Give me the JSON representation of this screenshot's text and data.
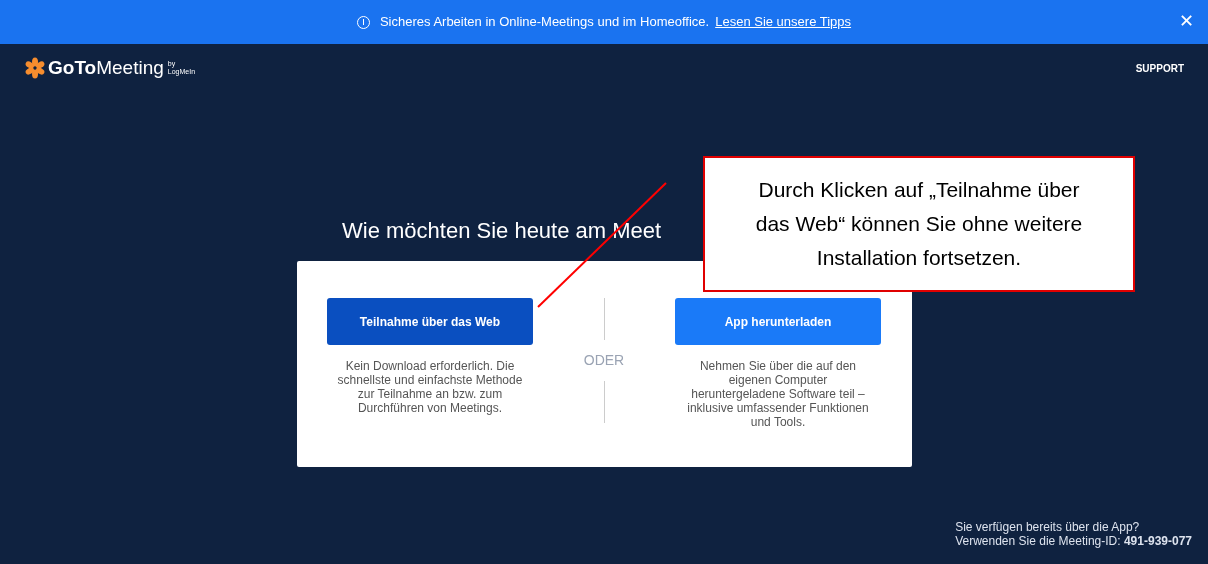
{
  "banner": {
    "message": "Sicheres Arbeiten in Online-Meetings und im Homeoffice.",
    "link": "Lesen Sie unsere Tipps",
    "close": "✕"
  },
  "header": {
    "logo": {
      "bold": "GoTo",
      "rest": "Meeting",
      "by": "by",
      "maker": "LogMeIn"
    },
    "support": "SUPPORT"
  },
  "heading": "Wie möchten Sie heute am Meet",
  "options": [
    {
      "label": "Teilnahme über das Web",
      "kind": "primary",
      "description": "Kein Download erforderlich. Die schnellste und einfachste Methode zur Teilnahme an bzw. zum Durchführen von Meetings."
    },
    {
      "label": "App herunterladen",
      "kind": "secondary",
      "description": "Nehmen Sie über die auf den eigenen Computer heruntergeladene Software teil – inklusive umfassender Funktionen und Tools."
    }
  ],
  "separator": "ODER",
  "footer": {
    "line1": "Sie verfügen bereits über die App?",
    "line2": "Verwenden Sie die Meeting-ID: **491-939-077**"
  },
  "callout": "Durch Klicken auf „Teilnahme über das Web“ können Sie ohne weitere Installation fortsetzen."
}
